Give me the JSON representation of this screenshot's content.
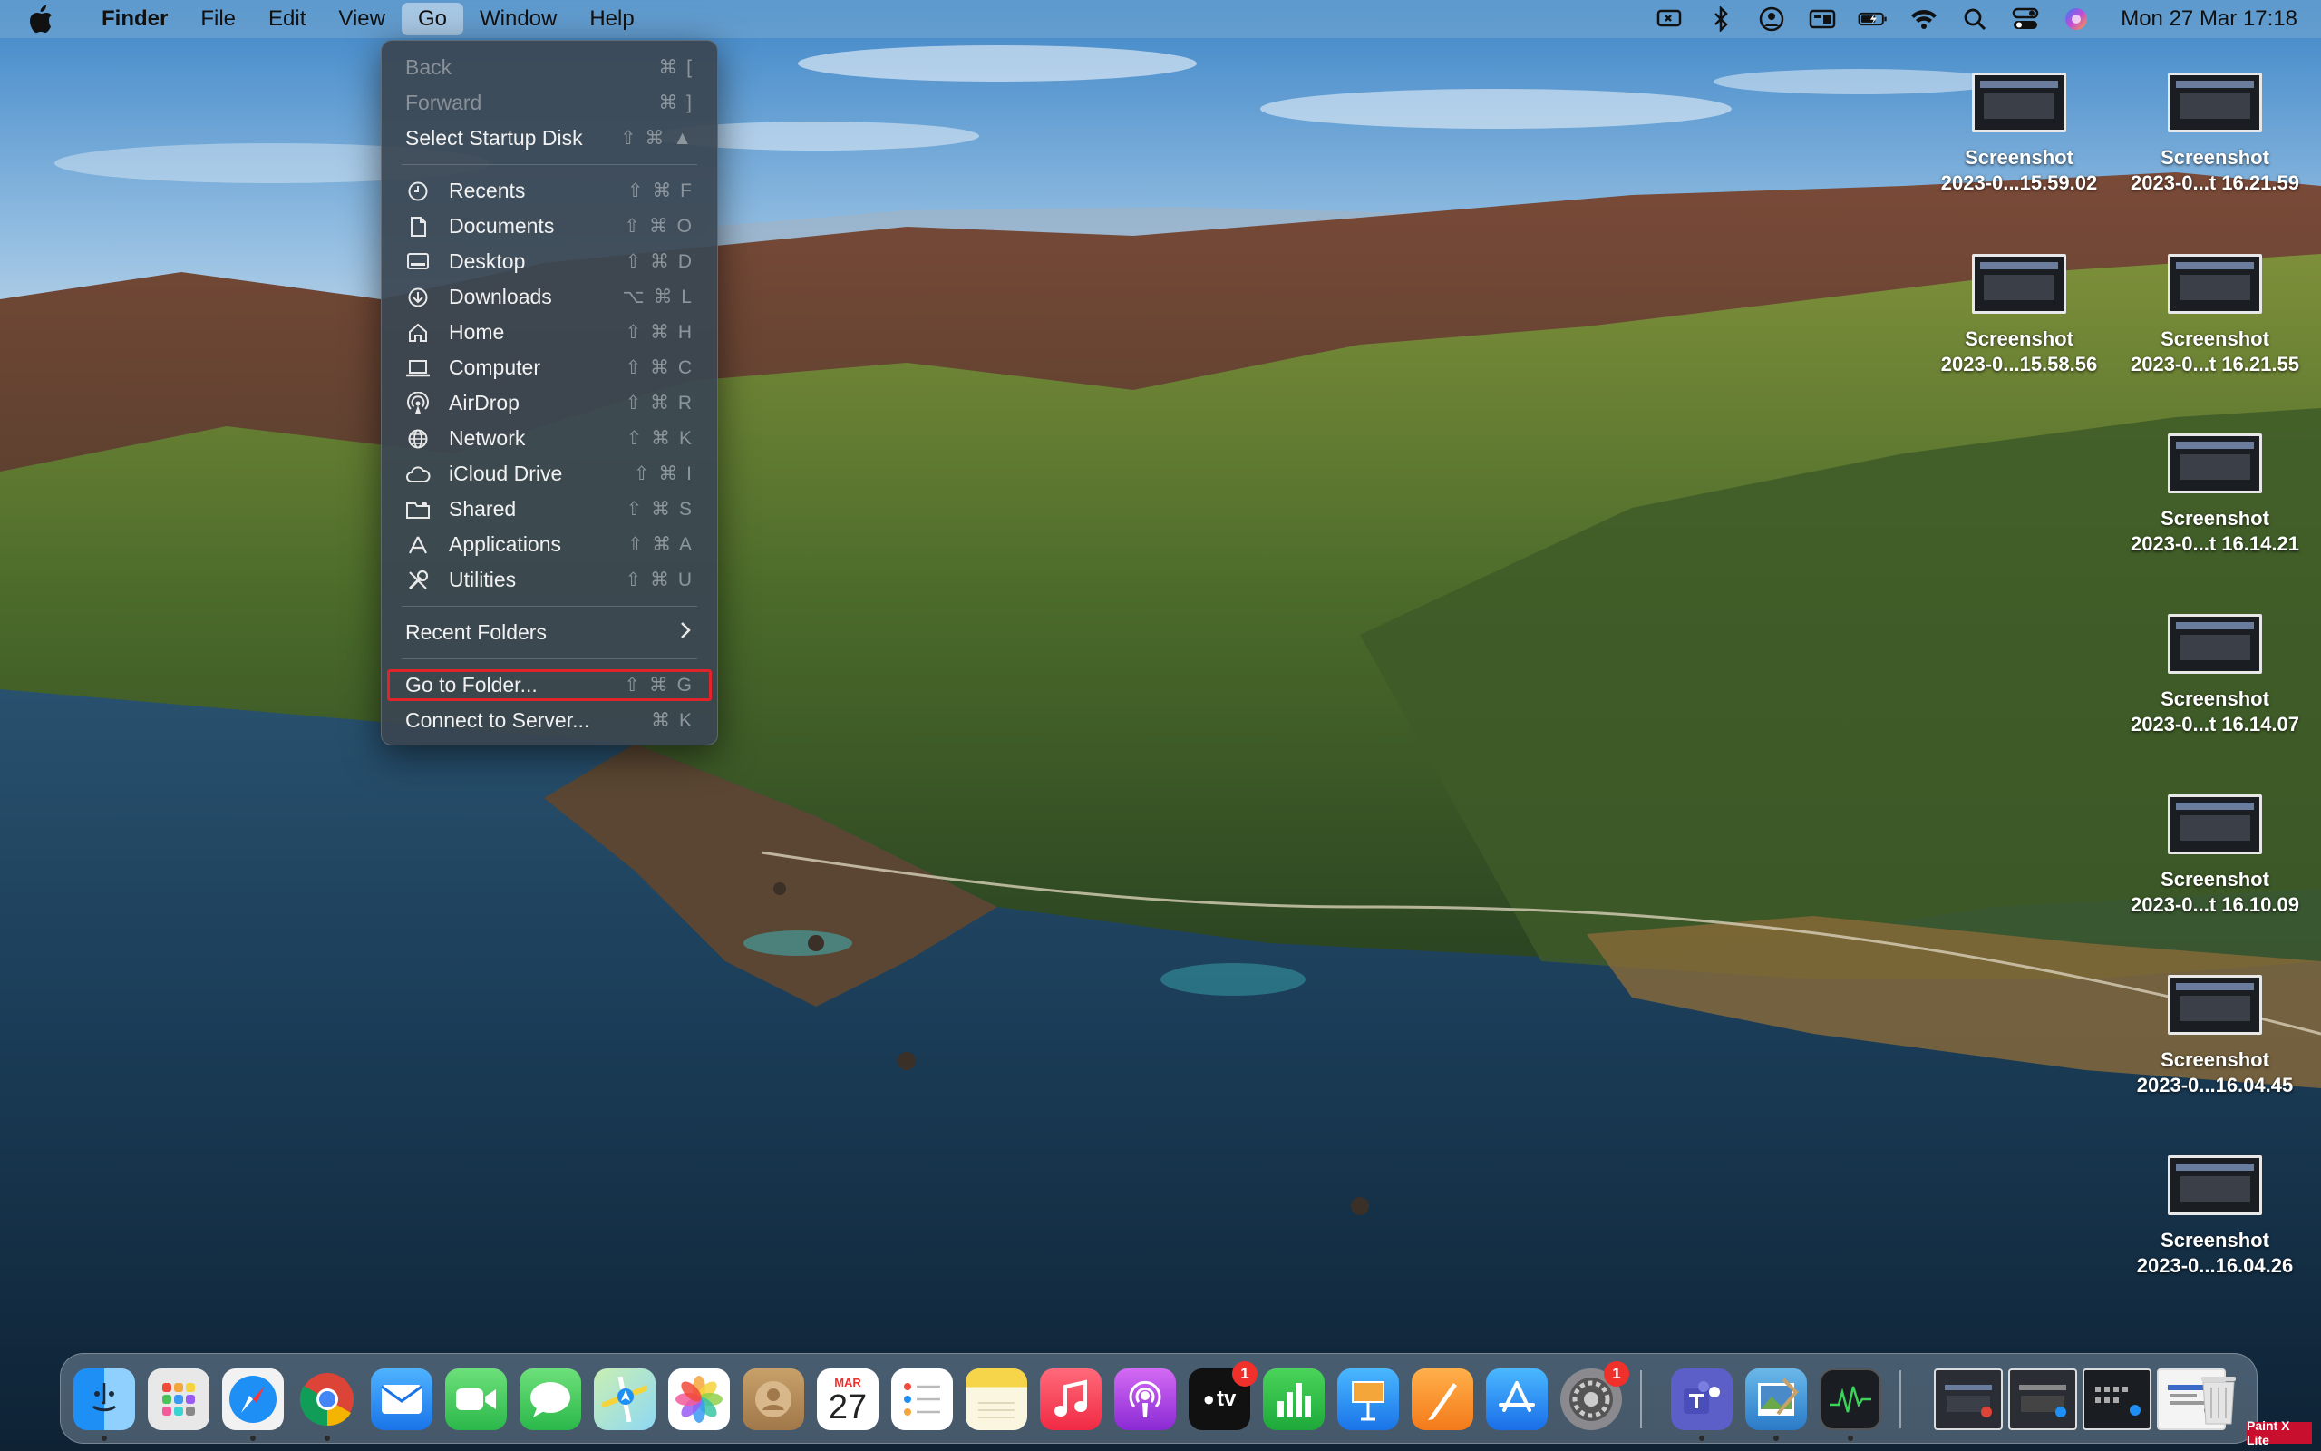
{
  "menubar": {
    "app_name": "Finder",
    "menus": [
      "File",
      "Edit",
      "View",
      "Go",
      "Window",
      "Help"
    ],
    "active_menu": "Go",
    "clock": "Mon 27 Mar  17:18",
    "status_icons": [
      "screen-mirroring-icon",
      "bluetooth-icon",
      "user-account-icon",
      "display-icon",
      "battery-icon",
      "wifi-icon",
      "spotlight-search-icon",
      "control-center-icon",
      "siri-icon"
    ]
  },
  "go_menu": {
    "top_items": [
      {
        "label": "Back",
        "shortcut": "⌘ [",
        "enabled": false
      },
      {
        "label": "Forward",
        "shortcut": "⌘ ]",
        "enabled": false
      },
      {
        "label": "Select Startup Disk",
        "shortcut": "⇧ ⌘ ▲",
        "enabled": true
      }
    ],
    "places": [
      {
        "label": "Recents",
        "shortcut": "⇧ ⌘ F",
        "icon": "clock-icon"
      },
      {
        "label": "Documents",
        "shortcut": "⇧ ⌘ O",
        "icon": "document-icon"
      },
      {
        "label": "Desktop",
        "shortcut": "⇧ ⌘ D",
        "icon": "desktop-icon"
      },
      {
        "label": "Downloads",
        "shortcut": "⌥ ⌘ L",
        "icon": "download-icon"
      },
      {
        "label": "Home",
        "shortcut": "⇧ ⌘ H",
        "icon": "home-icon"
      },
      {
        "label": "Computer",
        "shortcut": "⇧ ⌘ C",
        "icon": "laptop-icon"
      },
      {
        "label": "AirDrop",
        "shortcut": "⇧ ⌘ R",
        "icon": "airdrop-icon"
      },
      {
        "label": "Network",
        "shortcut": "⇧ ⌘ K",
        "icon": "globe-icon"
      },
      {
        "label": "iCloud Drive",
        "shortcut": "⇧ ⌘ I",
        "icon": "cloud-icon"
      },
      {
        "label": "Shared",
        "shortcut": "⇧ ⌘ S",
        "icon": "shared-folder-icon"
      },
      {
        "label": "Applications",
        "shortcut": "⇧ ⌘ A",
        "icon": "applications-icon"
      },
      {
        "label": "Utilities",
        "shortcut": "⇧ ⌘ U",
        "icon": "tools-icon"
      }
    ],
    "recent_folders": "Recent Folders",
    "go_to_folder": {
      "label": "Go to Folder...",
      "shortcut": "⇧ ⌘ G"
    },
    "connect_to_server": {
      "label": "Connect to Server...",
      "shortcut": "⌘ K"
    }
  },
  "desktop_files": [
    {
      "line1": "Screenshot",
      "line2": "2023-0...15.59.02"
    },
    {
      "line1": "Screenshot",
      "line2": "2023-0...t 16.21.59"
    },
    {
      "line1": "Screenshot",
      "line2": "2023-0...15.58.56"
    },
    {
      "line1": "Screenshot",
      "line2": "2023-0...t 16.21.55"
    },
    {
      "line1": "Screenshot",
      "line2": "2023-0...t 16.14.21"
    },
    {
      "line1": "Screenshot",
      "line2": "2023-0...t 16.14.07"
    },
    {
      "line1": "Screenshot",
      "line2": "2023-0...t 16.10.09"
    },
    {
      "line1": "Screenshot",
      "line2": "2023-0...16.04.45"
    },
    {
      "line1": "Screenshot",
      "line2": "2023-0...16.04.26"
    }
  ],
  "dock": {
    "calendar_month": "MAR",
    "calendar_day": "27",
    "tv_label": "tv",
    "tv_badge": "1",
    "settings_badge": "1"
  },
  "watermark": "Paint X Lite",
  "colors": {
    "highlight_border": "#e0242b",
    "menu_bg": "#3a4652"
  }
}
